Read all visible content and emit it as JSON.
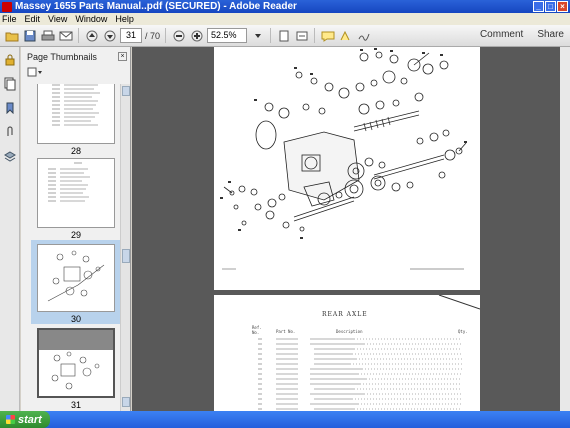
{
  "window": {
    "title": "Massey 1655 Parts Manual..pdf (SECURED) - Adobe Reader",
    "controls": [
      "_",
      "□",
      "×"
    ]
  },
  "menu": [
    "File",
    "Edit",
    "View",
    "Window",
    "Help"
  ],
  "toolbar": {
    "current_page": "31",
    "total_pages": "/ 70",
    "zoom": "52.5%",
    "comment_label": "Comment",
    "share_label": "Share"
  },
  "panel": {
    "title": "Page Thumbnails",
    "thumbnails": [
      {
        "label": "28",
        "selected": false
      },
      {
        "label": "29",
        "selected": false
      },
      {
        "label": "30",
        "selected": true
      },
      {
        "label": "31",
        "selected": false
      }
    ]
  },
  "document": {
    "page2_title": "REAR AXLE",
    "page2_col_headers": [
      "Ref.\nNo.",
      "Part No.",
      "Description",
      "Qty."
    ]
  },
  "taskbar": {
    "start_label": "start"
  }
}
